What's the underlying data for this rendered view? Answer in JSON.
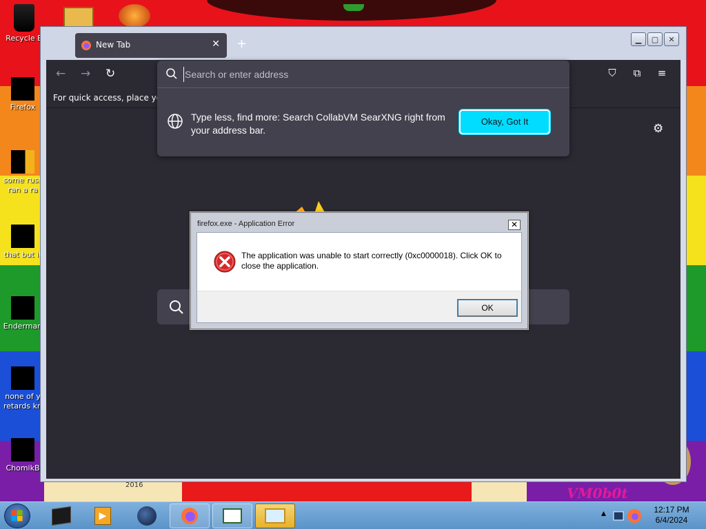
{
  "desktop": {
    "icons": [
      {
        "label": "Recycle B"
      },
      {
        "label": "Firefox"
      },
      {
        "label": "some russ\nran a ra"
      },
      {
        "label": "that but it"
      },
      {
        "label": "Enderman"
      },
      {
        "label": "none of y\nretards kn"
      },
      {
        "label": "ChomikB"
      }
    ],
    "wallpaper_text": "VM0b0t",
    "wallpaper_year": "2016"
  },
  "browser": {
    "tab_title": "New Tab",
    "url_placeholder": "Search or enter address",
    "bookmarks_hint": "For quick access, place your b",
    "tip_text": "Type less, find more: Search CollabVM SearXNG right from your address bar.",
    "tip_button": "Okay, Got It",
    "accent_color": "#00ddff"
  },
  "dialog": {
    "title": "firefox.exe - Application Error",
    "message": "The application was unable to start correctly (0xc0000018). Click OK to close the application.",
    "ok_label": "OK",
    "close_glyph": "✕"
  },
  "taskbar": {
    "time": "12:17 PM",
    "date": "6/4/2024"
  }
}
